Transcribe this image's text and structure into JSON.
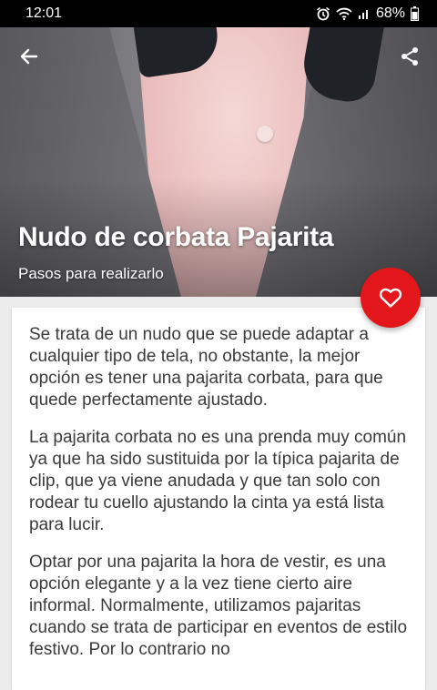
{
  "status_bar": {
    "time": "12:01",
    "battery": "68%",
    "icons": [
      "alarm-icon",
      "wifi-icon",
      "signal-icon",
      "battery-icon"
    ]
  },
  "header": {
    "back_icon": "arrow-left-icon",
    "share_icon": "share-icon",
    "title": "Nudo de corbata Pajarita",
    "subtitle": "Pasos para realizarlo",
    "favorite_icon": "heart-outline-icon"
  },
  "colors": {
    "accent": "#e3161b",
    "status_bar": "#000000",
    "page_background": "#ececec",
    "body_text": "#3a3a3a"
  },
  "content": {
    "paragraphs": [
      "Se trata de un nudo que se puede adaptar a cualquier tipo de tela, no obstante, la mejor opción es tener una pajarita corbata, para que quede perfectamente ajustado.",
      "La pajarita corbata no es una prenda muy común ya que ha sido sustituida por la típica pajarita de clip, que ya viene anudada y que tan solo con rodear tu cuello ajustando la cinta ya está lista para lucir.",
      "Optar por una pajarita la hora de vestir, es una opción elegante y a la vez tiene cierto aire informal. Normalmente, utilizamos pajaritas cuando se trata de participar en eventos de estilo festivo. Por lo contrario no"
    ]
  }
}
